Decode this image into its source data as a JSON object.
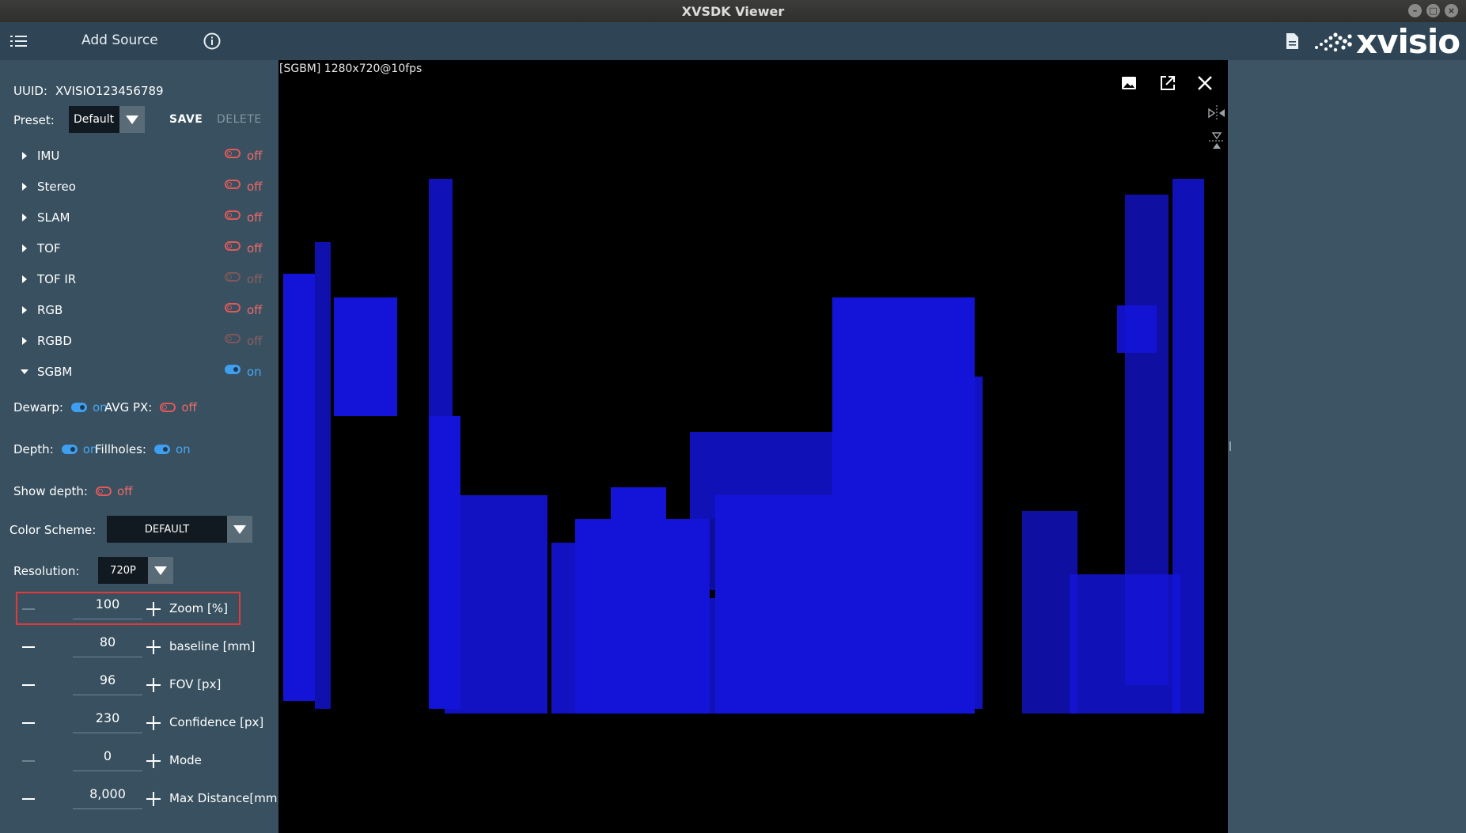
{
  "window": {
    "title": "XVSDK Viewer"
  },
  "toolbar": {
    "add_source": "Add Source",
    "menu_icon": "list-icon",
    "info_icon": "info-icon",
    "doc_icon": "document-icon",
    "logo_text": "xvisio"
  },
  "device": {
    "uuid_label": "UUID:",
    "uuid_value": "XVISIO123456789",
    "preset_label": "Preset:",
    "preset_value": "Default",
    "save_label": "SAVE",
    "delete_label": "DELETE"
  },
  "sections": [
    {
      "name": "IMU",
      "state": "off",
      "expanded": false
    },
    {
      "name": "Stereo",
      "state": "off",
      "expanded": false
    },
    {
      "name": "SLAM",
      "state": "off",
      "expanded": false
    },
    {
      "name": "TOF",
      "state": "off",
      "expanded": false
    },
    {
      "name": "TOF IR",
      "state": "off",
      "expanded": false,
      "disabled": true
    },
    {
      "name": "RGB",
      "state": "off",
      "expanded": false
    },
    {
      "name": "RGBD",
      "state": "off",
      "expanded": false,
      "disabled": true
    },
    {
      "name": "SGBM",
      "state": "on",
      "expanded": true
    }
  ],
  "sgbm": {
    "dewarp_label": "Dewarp:",
    "dewarp_state": "on",
    "avgpx_label": "AVG PX:",
    "avgpx_state": "off",
    "depth_label": "Depth:",
    "depth_state": "on",
    "fillholes_label": "Fillholes:",
    "fillholes_state": "on",
    "showdepth_label": "Show depth:",
    "showdepth_state": "off",
    "colorscheme_label": "Color Scheme:",
    "colorscheme_value": "DEFAULT",
    "resolution_label": "Resolution:",
    "resolution_value": "720P",
    "steppers": [
      {
        "value": "100",
        "label": "Zoom [%]"
      },
      {
        "value": "80",
        "label": "baseline [mm]"
      },
      {
        "value": "96",
        "label": "FOV [px]"
      },
      {
        "value": "230",
        "label": "Confidence [px]"
      },
      {
        "value": "0",
        "label": "Mode"
      },
      {
        "value": "8,000",
        "label": "Max Distance[mm]"
      }
    ]
  },
  "viewer": {
    "caption": "[SGBM]  1280x720@10fps"
  },
  "colors": {
    "on": "#4aa6f4",
    "off": "#f06a6a",
    "depth_blue": "#1414d8",
    "highlight": "#e23a3a"
  }
}
